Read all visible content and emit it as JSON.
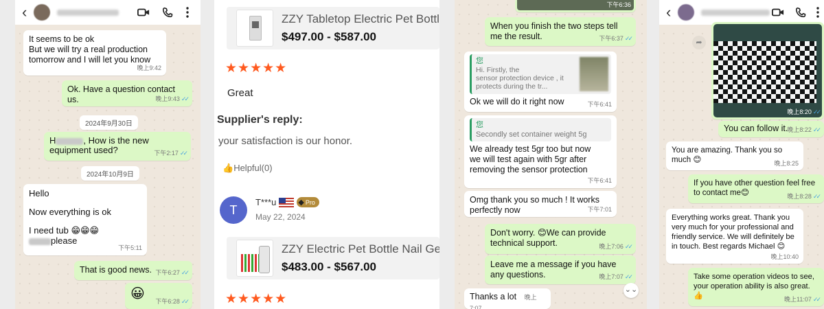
{
  "panel1": {
    "bubbles": [
      {
        "text": "It seems to be ok\nBut we will try a real production\ntomorrow and I will let you know",
        "time": "晚上9:42"
      },
      {
        "text": "Ok. Have a question contact us.",
        "time": "晚上9:43"
      },
      {
        "date": "2024年9月30日"
      },
      {
        "text_a": "H",
        "text_b": ", How is the new\nequipment used?",
        "time": "下午2:17"
      },
      {
        "date": "2024年10月9日"
      },
      {
        "l1": "Hello",
        "l2": "Now everything is ok",
        "l3": "I need tub 😁😁😁",
        "l4": "please",
        "time": "下午5:11"
      },
      {
        "text": "That is good news.",
        "time": "下午6:27"
      },
      {
        "text": "😀",
        "time": "下午6:28"
      }
    ]
  },
  "panel2": {
    "product1": {
      "title": "ZZY Tabletop Electric Pet Bottle",
      "price": "$497.00 - $587.00"
    },
    "stars": "★★★★★",
    "review_text": "Great",
    "supplier_heading": "Supplier's reply:",
    "supplier_reply": "your satisfaction is our honor.",
    "helpful": "Helpful(0)",
    "reviewer": {
      "initial": "T",
      "name": "T***u",
      "badge": "Pro",
      "date": "May 22, 2024"
    },
    "product2": {
      "title": "ZZY Electric Pet Bottle Nail Gel F",
      "price": "$483.00 - $567.00"
    }
  },
  "panel3": {
    "top_time": "下午6:36",
    "bubbles": [
      {
        "text": "When you finish the two steps tell\nme the result.",
        "time": "下午6:37"
      },
      {
        "quote_who": "您",
        "quote_text": "Hi. Firstly, the\nsensor protection device , it\nprotects during the tr...",
        "text": "Ok we will do it right now",
        "time": "下午6:41"
      },
      {
        "quote_who": "您",
        "quote_text": "Secondly set container weight 5g",
        "text": "We already test 5gr too but now\nwe will test again with 5gr after\nremoving the sensor protection",
        "time": "下午6:41"
      },
      {
        "text": "Omg thank you so much ! It works\nperfectly now",
        "time": "下午7:01"
      },
      {
        "text": "Don't worry. 😊We can provide\ntechnical support.",
        "time": "晚上7:06"
      },
      {
        "text": "Leave me a message if you have\nany questions.",
        "time": "晚上7:07"
      },
      {
        "text": "Thanks a lot",
        "time": "晚上7:07"
      }
    ]
  },
  "panel4": {
    "bubbles": [
      {
        "time": "晚上8:20"
      },
      {
        "text": "You can follow it.",
        "time": "晚上8:22"
      },
      {
        "text": "You are amazing. Thank you so\nmuch 😊",
        "time": "晚上8:25"
      },
      {
        "text": "If you have other  question feel free\nto contact me😊",
        "time": "晚上8:28"
      },
      {
        "text": "Everything works great. Thank you\nvery much for your professional and\nfriendly service. We will definitely be\nin touch. Best regards Michael 😊",
        "time": "晚上10:40"
      },
      {
        "text": "Take some operation videos to see,\nyour operation ability is also great.\n👍",
        "time": "晚上11:07"
      }
    ]
  },
  "colors": {
    "outgoing": "#dcf8c6",
    "incoming": "#ffffff",
    "stars": "#ff5a1f",
    "read_tick": "#4aa3df",
    "quote_accent": "#2a9d62"
  }
}
